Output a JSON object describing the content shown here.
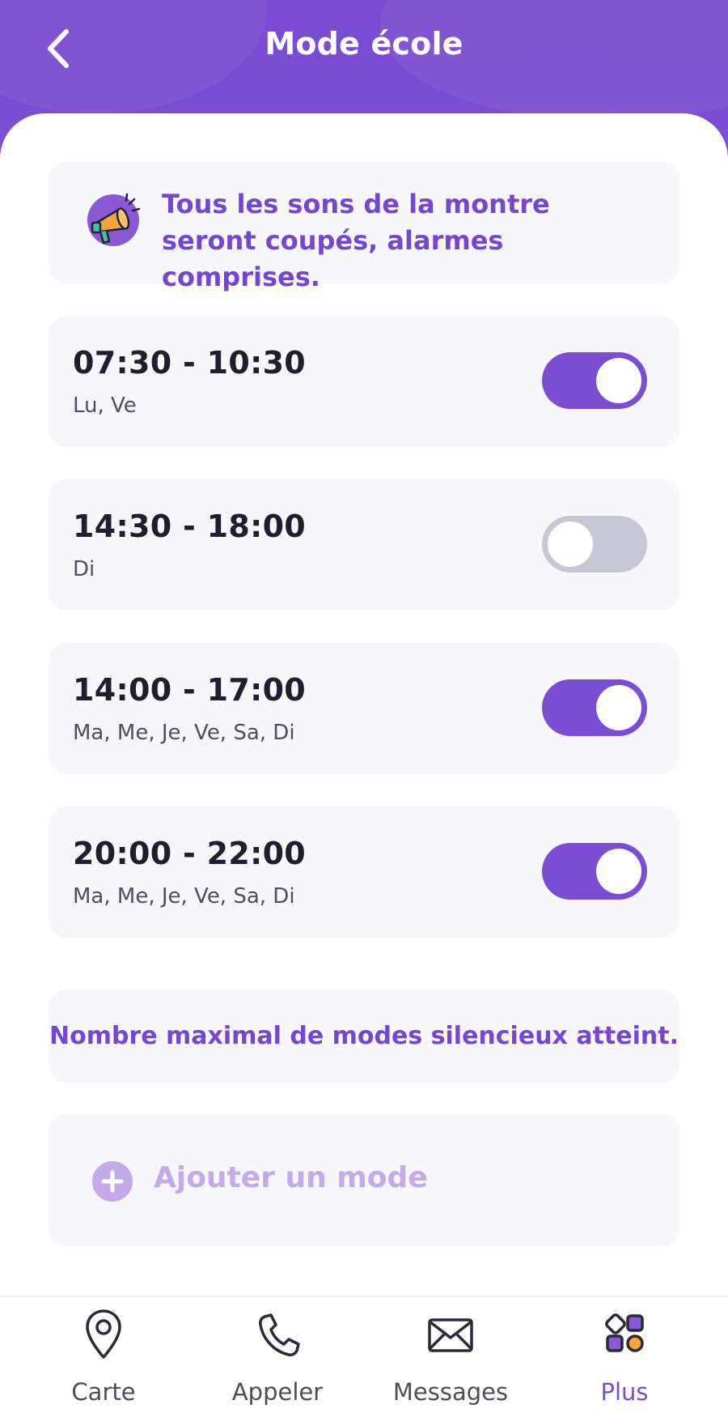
{
  "header": {
    "title": "Mode école",
    "back_icon": "chevron-left-icon"
  },
  "info": {
    "icon": "megaphone-icon",
    "text": "Tous les sons de la montre seront coupés, alarmes comprises."
  },
  "modes": [
    {
      "time": "07:30 - 10:30",
      "days": "Lu, Ve",
      "enabled": true
    },
    {
      "time": "14:30 - 18:00",
      "days": "Di",
      "enabled": false
    },
    {
      "time": "14:00 - 17:00",
      "days": "Ma, Me, Je, Ve, Sa, Di",
      "enabled": true
    },
    {
      "time": "20:00 - 22:00",
      "days": "Ma, Me, Je, Ve, Sa, Di",
      "enabled": true
    }
  ],
  "limit_message": "Nombre maximal de modes silencieux atteint.",
  "add_mode": {
    "label": "Ajouter un mode",
    "icon": "plus-circle-icon"
  },
  "tabbar": {
    "items": [
      {
        "label": "Carte",
        "icon": "map-pin-icon"
      },
      {
        "label": "Appeler",
        "icon": "phone-icon"
      },
      {
        "label": "Messages",
        "icon": "envelope-icon"
      },
      {
        "label": "Plus",
        "icon": "grid-icon"
      }
    ],
    "active": "Plus"
  },
  "colors": {
    "brand": "#7a4dd3",
    "toggle_on": "#7a4dd3",
    "toggle_off": "#c7c8d6",
    "card_bg": "#f7f7fb",
    "add_disabled": "#c2aaeb",
    "accent_orange": "#f3a43a"
  }
}
